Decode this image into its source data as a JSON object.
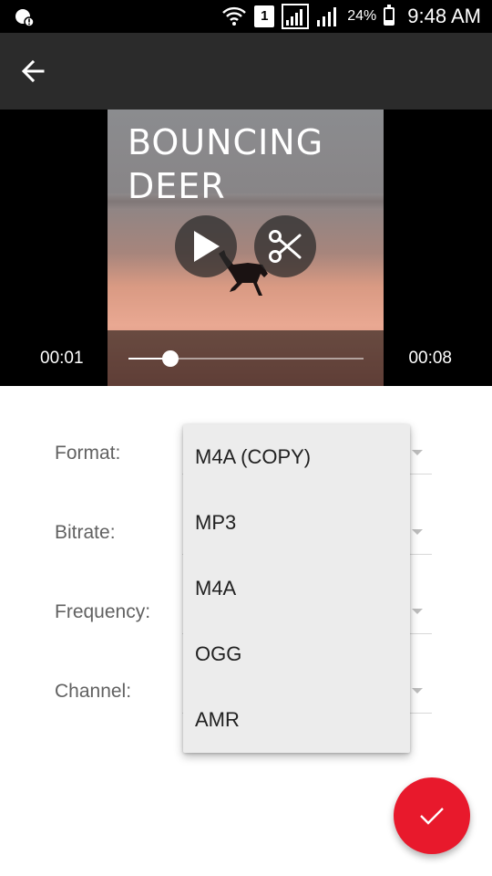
{
  "status_bar": {
    "battery_text": "24%",
    "battery_level": 0.24,
    "sim_slot": "1",
    "time": "9:48 AM",
    "icons": [
      "notification-icon",
      "wifi-icon",
      "sim-icon",
      "signal-icon",
      "signal-icon",
      "battery-icon"
    ]
  },
  "app_bar": {
    "back_icon": "back-arrow-icon"
  },
  "video": {
    "title_line1": "BOUNCING",
    "title_line2": "DEER",
    "current_time": "00:01",
    "duration": "00:08",
    "progress": 0.18,
    "play_icon": "play-icon",
    "cut_icon": "scissors-icon"
  },
  "form": {
    "format_label": "Format:",
    "bitrate_label": "Bitrate:",
    "frequency_label": "Frequency:",
    "channel_label": "Channel:"
  },
  "format_dropdown": {
    "options": [
      "M4A (COPY)",
      "MP3",
      "M4A",
      "OGG",
      "AMR"
    ]
  },
  "fab": {
    "icon": "checkmark-icon",
    "color": "#e8192c"
  },
  "colors": {
    "status_bar": "#000000",
    "app_bar": "#2b2b2b",
    "accent": "#e8192c",
    "label_text": "#616161"
  }
}
